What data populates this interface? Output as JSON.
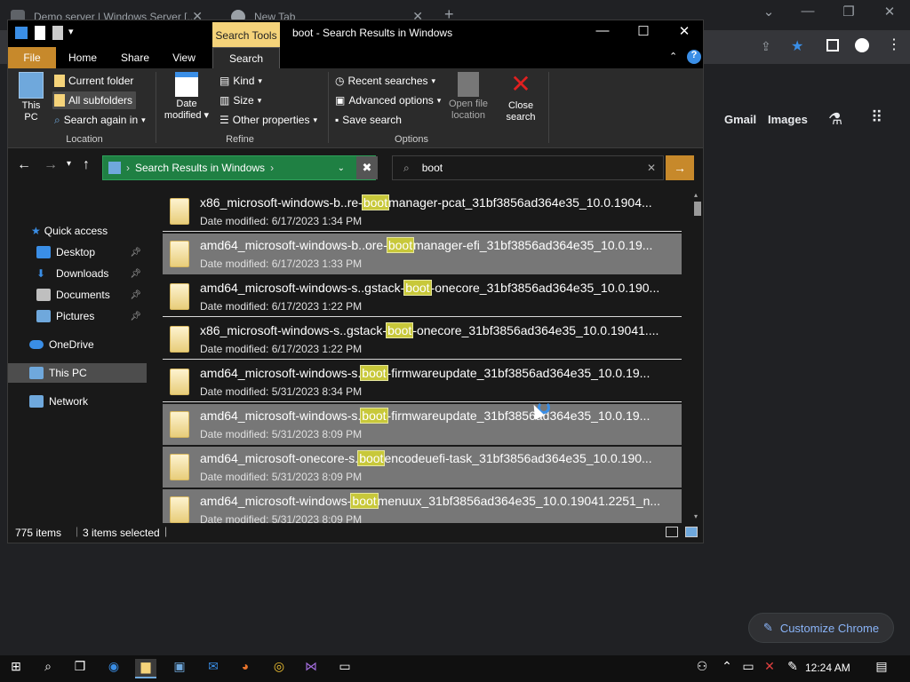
{
  "chrome": {
    "tabs": [
      {
        "label": "Demo server | Windows Server [...",
        "favicon_color": "#5f6368"
      },
      {
        "label": "New Tab",
        "favicon_color": "#9aa0a6"
      }
    ],
    "new_tab": "+",
    "links": {
      "gmail": "Gmail",
      "images": "Images"
    },
    "customize": "Customize Chrome"
  },
  "explorer": {
    "title": "boot - Search Results in Windows",
    "context_tab": "Search Tools",
    "window_buttons": {
      "minimize": "—",
      "maximize": "☐",
      "close": "✕"
    },
    "ribbon_tabs": [
      "File",
      "Home",
      "Share",
      "View",
      "Search"
    ],
    "ribbon": {
      "location": {
        "this_pc": "This PC",
        "current_folder": "Current folder",
        "all_subfolders": "All subfolders",
        "search_again": "Search again in",
        "label": "Location"
      },
      "refine": {
        "date_modified": "Date modified",
        "kind": "Kind",
        "size": "Size",
        "other_properties": "Other properties",
        "label": "Refine"
      },
      "options": {
        "recent_searches": "Recent searches",
        "advanced_options": "Advanced options",
        "save_search": "Save search",
        "open_file_location": "Open file location",
        "close_search": "Close search",
        "label": "Options"
      }
    },
    "address": "Search Results in Windows",
    "search_query": "boot",
    "nav": [
      {
        "label": "Quick access",
        "pinned": false,
        "color": "#3a8ee6"
      },
      {
        "label": "Desktop",
        "pinned": true,
        "color": "#3a8ee6"
      },
      {
        "label": "Downloads",
        "pinned": true,
        "color": "#3a8ee6"
      },
      {
        "label": "Documents",
        "pinned": true,
        "color": "#9aa0a6"
      },
      {
        "label": "Pictures",
        "pinned": true,
        "color": "#6fa8dc"
      },
      {
        "label": "OneDrive",
        "pinned": false,
        "color": "#3a8ee6"
      },
      {
        "label": "This PC",
        "pinned": false,
        "color": "#6fa8dc"
      },
      {
        "label": "Network",
        "pinned": false,
        "color": "#6fa8dc"
      }
    ],
    "results": [
      {
        "pre": "x86_microsoft-windows-b..re-",
        "kw": "boot",
        "post": "manager-pcat_31bf3856ad364e35_10.0.1904...",
        "date": "Date modified: 6/17/2023 1:34 PM",
        "selected": false
      },
      {
        "pre": "amd64_microsoft-windows-b..ore-",
        "kw": "boot",
        "post": "manager-efi_31bf3856ad364e35_10.0.19...",
        "date": "Date modified: 6/17/2023 1:33 PM",
        "selected": true
      },
      {
        "pre": "amd64_microsoft-windows-s..gstack-",
        "kw": "boot",
        "post": "-onecore_31bf3856ad364e35_10.0.190...",
        "date": "Date modified: 6/17/2023 1:22 PM",
        "selected": false
      },
      {
        "pre": "x86_microsoft-windows-s..gstack-",
        "kw": "boot",
        "post": "-onecore_31bf3856ad364e35_10.0.19041....",
        "date": "Date modified: 6/17/2023 1:22 PM",
        "selected": false
      },
      {
        "pre": "amd64_microsoft-windows-s.",
        "kw": "boot",
        "post": "-firmwareupdate_31bf3856ad364e35_10.0.19...",
        "date": "Date modified: 5/31/2023 8:34 PM",
        "selected": false
      },
      {
        "pre": "amd64_microsoft-windows-s.",
        "kw": "boot",
        "post": "-firmwareupdate_31bf3856ad364e35_10.0.19...",
        "date": "Date modified: 5/31/2023 8:09 PM",
        "selected": true
      },
      {
        "pre": "amd64_microsoft-onecore-s.",
        "kw": "boot",
        "post": "encodeuefi-task_31bf3856ad364e35_10.0.190...",
        "date": "Date modified: 5/31/2023 8:09 PM",
        "selected": true
      },
      {
        "pre": "amd64_microsoft-windows-",
        "kw": "boot",
        "post": "menuux_31bf3856ad364e35_10.0.19041.2251_n...",
        "date": "Date modified: 5/31/2023 8:09 PM",
        "selected": true
      }
    ],
    "status": {
      "items": "775 items",
      "selected": "3 items selected"
    }
  },
  "taskbar": {
    "time": "12:24 AM"
  }
}
